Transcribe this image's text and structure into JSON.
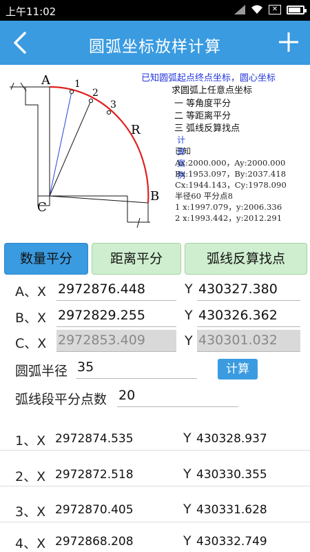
{
  "status": {
    "time": "上午11:02"
  },
  "appbar": {
    "title": "圆弧坐标放样计算"
  },
  "diagram": {
    "labels": {
      "a": "A",
      "b": "B",
      "c": "C",
      "r": "R",
      "p1": "1",
      "p2": "2",
      "p3": "3"
    },
    "info_title": "已知圆弧起点终点坐标，圆心坐标",
    "info_subtitle": "求圆弧上任意点坐标",
    "methods": [
      "一  等角度平分",
      "二  等距离平分",
      "三  弧线反算找点"
    ],
    "case_title": "计算案例",
    "example": [
      "已知",
      "Ax:2000.000，Ay:2000.000",
      "Bx:1953.097，By:2037.418",
      "Cx:1944.143，Cy:1978.090",
      "半径60    平分点8",
      "1 x:1997.079，y:2006.336",
      "2 x:1993.442，y:2012.291"
    ]
  },
  "tabs": [
    "数量平分",
    "距离平分",
    "弧线反算找点"
  ],
  "inputs": {
    "a": {
      "label": "A、X",
      "x": "2972876.448",
      "ylabel": "Y",
      "y": "430327.380"
    },
    "b": {
      "label": "B、X",
      "x": "2972829.255",
      "ylabel": "Y",
      "y": "430326.362"
    },
    "c": {
      "label": "C、X",
      "x": "2972853.409",
      "ylabel": "Y",
      "y": "430301.032"
    },
    "radius_label": "圆弧半径",
    "radius": "35",
    "calc_label": "计算",
    "points_label": "弧线段平分点数",
    "points": "20"
  },
  "results": [
    {
      "label": "1、X",
      "x": "2972874.535",
      "ylabel": "Y",
      "y": "430328.937"
    },
    {
      "label": "2、X",
      "x": "2972872.518",
      "ylabel": "Y",
      "y": "430330.355"
    },
    {
      "label": "3、X",
      "x": "2972870.405",
      "ylabel": "Y",
      "y": "430331.628"
    },
    {
      "label": "4、X",
      "x": "2972868.208",
      "ylabel": "Y",
      "y": "430332.749"
    }
  ],
  "colors": {
    "accent": "#3a9be0",
    "tab_inactive": "#cfeecf",
    "arc": "#e02020"
  }
}
